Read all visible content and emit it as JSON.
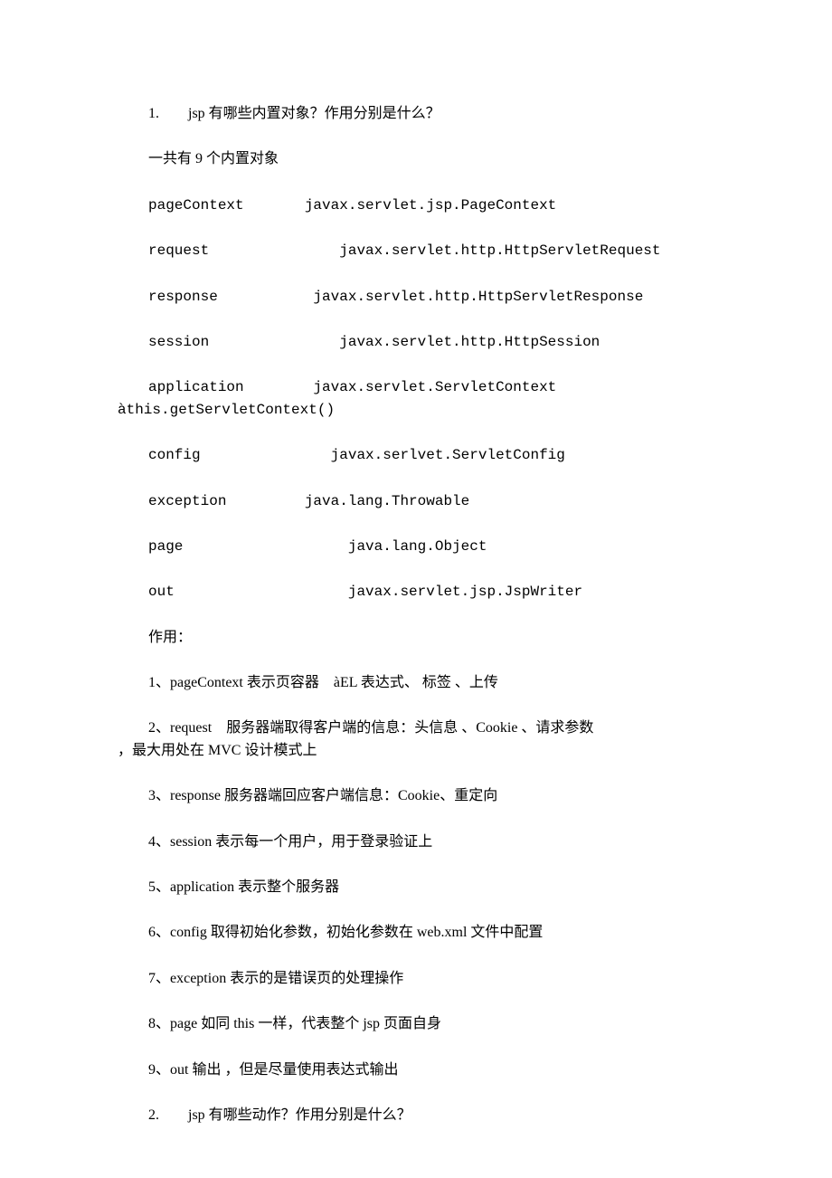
{
  "lines": {
    "q1": "1.        jsp 有哪些内置对象？作用分别是什么？",
    "intro": "一共有 9 个内置对象",
    "obj1": "pageContext       javax.servlet.jsp.PageContext",
    "obj2": "request               javax.servlet.http.HttpServletRequest",
    "obj3": "response           javax.servlet.http.HttpServletResponse",
    "obj4": "session               javax.servlet.http.HttpSession",
    "obj5a": "application        javax.servlet.ServletContext",
    "obj5b": "àthis.getServletContext()",
    "obj6": "config               javax.serlvet.ServletConfig",
    "obj7": "exception         java.lang.Throwable",
    "obj8": "page                   java.lang.Object",
    "obj9": "out                    javax.servlet.jsp.JspWriter",
    "usage_header": "作用：",
    "u1": "1、pageContext 表示页容器    àEL 表达式、 标签 、上传",
    "u2a": "2、request    服务器端取得客户端的信息：头信息 、Cookie 、请求参数",
    "u2b": "，最大用处在 MVC 设计模式上",
    "u3": "3、response 服务器端回应客户端信息：Cookie、重定向",
    "u4": "4、session 表示每一个用户，用于登录验证上",
    "u5": "5、application 表示整个服务器",
    "u6": "6、config 取得初始化参数，初始化参数在 web.xml 文件中配置",
    "u7": "7、exception 表示的是错误页的处理操作",
    "u8": "8、page 如同 this 一样，代表整个 jsp 页面自身",
    "u9": "9、out 输出 ，但是尽量使用表达式输出",
    "q2": "2.        jsp 有哪些动作？作用分别是什么？"
  }
}
